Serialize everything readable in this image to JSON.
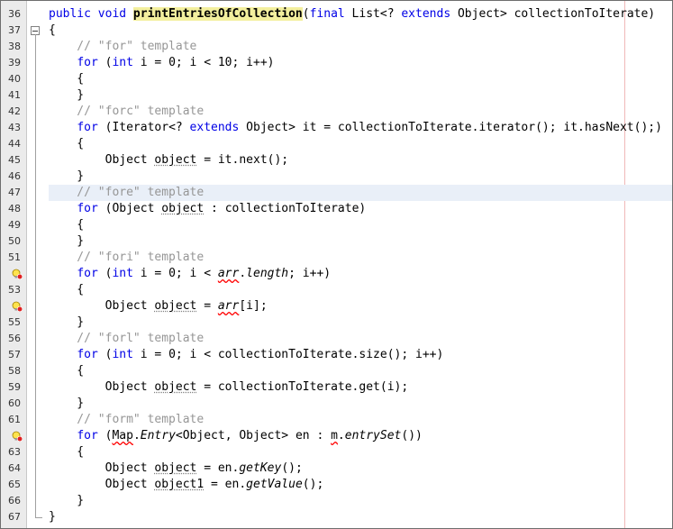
{
  "editor": {
    "language": "java",
    "colors": {
      "keyword": "#0000e6",
      "comment": "#969696",
      "method_highlight": "#f3ef9e",
      "current_line": "#e9eff8",
      "margin_line": "#f0b8b8",
      "error_underline": "#ff0000"
    },
    "lines": [
      {
        "num": "36",
        "tokens": [
          {
            "t": "public void ",
            "s": "kw"
          },
          {
            "t": "printEntriesOfCollection",
            "s": "fn"
          },
          {
            "t": "(",
            "s": ""
          },
          {
            "t": "final",
            "s": "kw"
          },
          {
            "t": " List<? ",
            "s": ""
          },
          {
            "t": "extends",
            "s": "kw"
          },
          {
            "t": " Object> collectionToIterate)",
            "s": ""
          }
        ]
      },
      {
        "num": "37",
        "fold": "box",
        "tokens": [
          {
            "t": "{",
            "s": ""
          }
        ]
      },
      {
        "num": "38",
        "fold": "line",
        "tokens": [
          {
            "t": "    // \"for\" template",
            "s": "cm"
          }
        ]
      },
      {
        "num": "39",
        "fold": "line",
        "tokens": [
          {
            "t": "    ",
            "s": ""
          },
          {
            "t": "for",
            "s": "kw"
          },
          {
            "t": " (",
            "s": ""
          },
          {
            "t": "int",
            "s": "kw"
          },
          {
            "t": " i = 0; i < 10; i++)",
            "s": ""
          }
        ]
      },
      {
        "num": "40",
        "fold": "line",
        "tokens": [
          {
            "t": "    {",
            "s": ""
          }
        ]
      },
      {
        "num": "41",
        "fold": "line",
        "tokens": [
          {
            "t": "    }",
            "s": ""
          }
        ]
      },
      {
        "num": "42",
        "fold": "line",
        "tokens": [
          {
            "t": "    // \"forc\" template",
            "s": "cm"
          }
        ]
      },
      {
        "num": "43",
        "fold": "line",
        "tokens": [
          {
            "t": "    ",
            "s": ""
          },
          {
            "t": "for",
            "s": "kw"
          },
          {
            "t": " (Iterator<? ",
            "s": ""
          },
          {
            "t": "extends",
            "s": "kw"
          },
          {
            "t": " Object> it = collectionToIterate.iterator(); it.hasNext();)",
            "s": ""
          }
        ]
      },
      {
        "num": "44",
        "fold": "line",
        "tokens": [
          {
            "t": "    {",
            "s": ""
          }
        ]
      },
      {
        "num": "45",
        "fold": "line",
        "tokens": [
          {
            "t": "        Object ",
            "s": ""
          },
          {
            "t": "object",
            "s": "warn"
          },
          {
            "t": " = it.next();",
            "s": ""
          }
        ]
      },
      {
        "num": "46",
        "fold": "line",
        "tokens": [
          {
            "t": "    }",
            "s": ""
          }
        ]
      },
      {
        "num": "47",
        "fold": "line",
        "current": true,
        "tokens": [
          {
            "t": "    // \"fore\" template",
            "s": "cm"
          }
        ]
      },
      {
        "num": "48",
        "fold": "line",
        "tokens": [
          {
            "t": "    ",
            "s": ""
          },
          {
            "t": "for",
            "s": "kw"
          },
          {
            "t": " (Object ",
            "s": ""
          },
          {
            "t": "object",
            "s": "warn"
          },
          {
            "t": " : collectionToIterate)",
            "s": ""
          }
        ]
      },
      {
        "num": "49",
        "fold": "line",
        "tokens": [
          {
            "t": "    {",
            "s": ""
          }
        ]
      },
      {
        "num": "50",
        "fold": "line",
        "tokens": [
          {
            "t": "    }",
            "s": ""
          }
        ]
      },
      {
        "num": "51",
        "fold": "line",
        "tokens": [
          {
            "t": "    // \"fori\" template",
            "s": "cm"
          }
        ]
      },
      {
        "num": "",
        "fold": "line",
        "hint": true,
        "tokens": [
          {
            "t": "    ",
            "s": ""
          },
          {
            "t": "for",
            "s": "kw"
          },
          {
            "t": " (",
            "s": ""
          },
          {
            "t": "int",
            "s": "kw"
          },
          {
            "t": " i = 0; i < ",
            "s": ""
          },
          {
            "t": "arr",
            "s": "err-it"
          },
          {
            "t": ".",
            "s": ""
          },
          {
            "t": "length",
            "s": "it"
          },
          {
            "t": "; i++)",
            "s": ""
          }
        ]
      },
      {
        "num": "53",
        "fold": "line",
        "tokens": [
          {
            "t": "    {",
            "s": ""
          }
        ]
      },
      {
        "num": "",
        "fold": "line",
        "hint": true,
        "tokens": [
          {
            "t": "        Object ",
            "s": ""
          },
          {
            "t": "object",
            "s": "warn"
          },
          {
            "t": " = ",
            "s": ""
          },
          {
            "t": "arr",
            "s": "err-it"
          },
          {
            "t": "[i];",
            "s": ""
          }
        ]
      },
      {
        "num": "55",
        "fold": "line",
        "tokens": [
          {
            "t": "    }",
            "s": ""
          }
        ]
      },
      {
        "num": "56",
        "fold": "line",
        "tokens": [
          {
            "t": "    // \"forl\" template",
            "s": "cm"
          }
        ]
      },
      {
        "num": "57",
        "fold": "line",
        "tokens": [
          {
            "t": "    ",
            "s": ""
          },
          {
            "t": "for",
            "s": "kw"
          },
          {
            "t": " (",
            "s": ""
          },
          {
            "t": "int",
            "s": "kw"
          },
          {
            "t": " i = 0; i < collectionToIterate.size(); i++)",
            "s": ""
          }
        ]
      },
      {
        "num": "58",
        "fold": "line",
        "tokens": [
          {
            "t": "    {",
            "s": ""
          }
        ]
      },
      {
        "num": "59",
        "fold": "line",
        "tokens": [
          {
            "t": "        Object ",
            "s": ""
          },
          {
            "t": "object",
            "s": "warn"
          },
          {
            "t": " = collectionToIterate.get(i);",
            "s": ""
          }
        ]
      },
      {
        "num": "60",
        "fold": "line",
        "tokens": [
          {
            "t": "    }",
            "s": ""
          }
        ]
      },
      {
        "num": "61",
        "fold": "line",
        "tokens": [
          {
            "t": "    // \"form\" template",
            "s": "cm"
          }
        ]
      },
      {
        "num": "",
        "fold": "line",
        "hint": true,
        "tokens": [
          {
            "t": "    ",
            "s": ""
          },
          {
            "t": "for",
            "s": "kw"
          },
          {
            "t": " (",
            "s": ""
          },
          {
            "t": "Map",
            "s": "err"
          },
          {
            "t": ".",
            "s": ""
          },
          {
            "t": "Entry",
            "s": "it"
          },
          {
            "t": "<Object, Object> en : ",
            "s": ""
          },
          {
            "t": "m",
            "s": "err"
          },
          {
            "t": ".",
            "s": ""
          },
          {
            "t": "entrySet",
            "s": "it"
          },
          {
            "t": "())",
            "s": ""
          }
        ]
      },
      {
        "num": "63",
        "fold": "line",
        "tokens": [
          {
            "t": "    {",
            "s": ""
          }
        ]
      },
      {
        "num": "64",
        "fold": "line",
        "tokens": [
          {
            "t": "        Object ",
            "s": ""
          },
          {
            "t": "object",
            "s": "warn"
          },
          {
            "t": " = en.",
            "s": ""
          },
          {
            "t": "getKey",
            "s": "it"
          },
          {
            "t": "();",
            "s": ""
          }
        ]
      },
      {
        "num": "65",
        "fold": "line",
        "tokens": [
          {
            "t": "        Object ",
            "s": ""
          },
          {
            "t": "object1",
            "s": "warn"
          },
          {
            "t": " = en.",
            "s": ""
          },
          {
            "t": "getValue",
            "s": "it"
          },
          {
            "t": "();",
            "s": ""
          }
        ]
      },
      {
        "num": "66",
        "fold": "line",
        "tokens": [
          {
            "t": "    }",
            "s": ""
          }
        ]
      },
      {
        "num": "67",
        "fold": "end",
        "tokens": [
          {
            "t": "}",
            "s": ""
          }
        ]
      }
    ]
  }
}
